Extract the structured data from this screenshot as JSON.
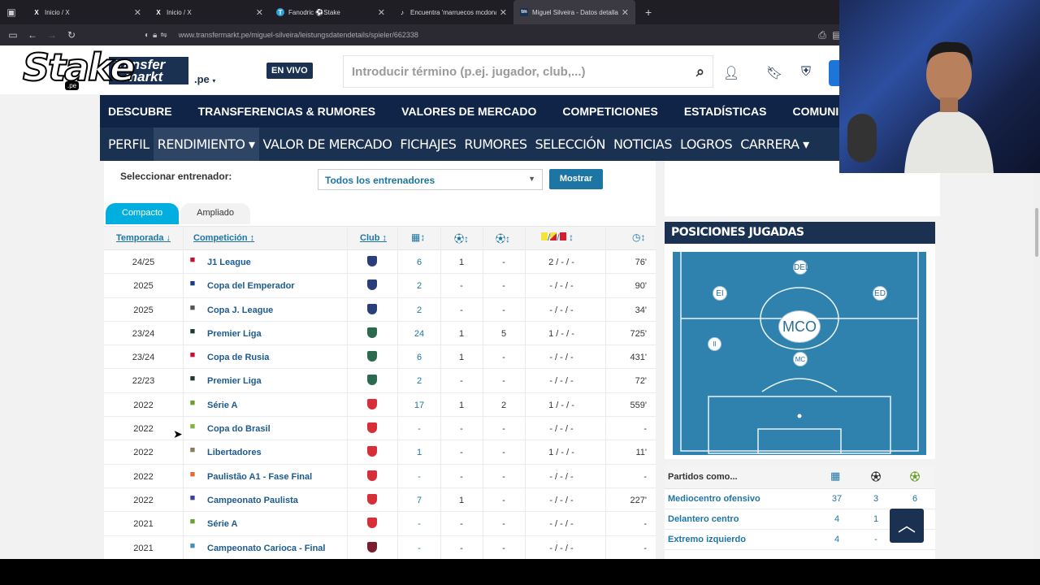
{
  "browser": {
    "tabs": [
      {
        "title": "Inicio / X",
        "icon": "X"
      },
      {
        "title": "Inicio / X",
        "icon": "X"
      },
      {
        "title": "Fanodric ⚽Stake",
        "icon": "T"
      },
      {
        "title": "Encuentra 'marruecos mcdonal",
        "icon": "♪"
      },
      {
        "title": "Miguel Silveira - Datos detallad",
        "icon": "tm"
      }
    ],
    "url": "www.transfermarkt.pe/miguel-silveira/leistungsdatendetails/spieler/662338"
  },
  "overlay": {
    "stake_logo": "Stake",
    "stake_sub": ".pe"
  },
  "site": {
    "logo_line1": "transfer",
    "logo_line2": "markt",
    "domain": ".pe",
    "live_badge": "EN VIVO",
    "search_placeholder": "Introducir término (p.ej. jugador, club,...)"
  },
  "main_nav": [
    "DESCUBRE",
    "TRANSFERENCIAS & RUMORES",
    "VALORES DE MERCADO",
    "COMPETICIONES",
    "ESTADÍSTICAS",
    "COMUNIDAD"
  ],
  "sub_nav": [
    "PERFIL",
    "RENDIMIENTO ▾",
    "VALOR DE MERCADO",
    "FICHAJES",
    "RUMORES",
    "SELECCIÓN",
    "NOTICIAS",
    "LOGROS",
    "CARRERA ▾"
  ],
  "filters": {
    "coach_label": "Seleccionar entrenador:",
    "coach_value": "Todos los entrenadores",
    "show_button": "Mostrar"
  },
  "view_tabs": {
    "compact": "Compacto",
    "wide": "Ampliado"
  },
  "table": {
    "headers": {
      "season": "Temporada ↓",
      "competition": "Competición ↕",
      "club": "Club ↕"
    },
    "rows": [
      {
        "season": "24/25",
        "competition": "J1 League",
        "apps": "6",
        "goals": "1",
        "assists": "-",
        "cards": "2 / - / -",
        "minutes": "76'",
        "logo_color": "#c8102e",
        "club_color": "#2a3f7a"
      },
      {
        "season": "2025",
        "competition": "Copa del Emperador",
        "apps": "2",
        "goals": "-",
        "assists": "-",
        "cards": "- / - / -",
        "minutes": "90'",
        "logo_color": "#1a3a8a",
        "club_color": "#2a3f7a"
      },
      {
        "season": "2025",
        "competition": "Copa J. League",
        "apps": "2",
        "goals": "-",
        "assists": "-",
        "cards": "- / - / -",
        "minutes": "34'",
        "logo_color": "#555555",
        "club_color": "#2a3f7a"
      },
      {
        "season": "23/24",
        "competition": "Premier Liga",
        "apps": "24",
        "goals": "1",
        "assists": "5",
        "cards": "1 / - / -",
        "minutes": "725'",
        "logo_color": "#1f3a2a",
        "club_color": "#2c6a50"
      },
      {
        "season": "23/24",
        "competition": "Copa de Rusia",
        "apps": "6",
        "goals": "1",
        "assists": "-",
        "cards": "- / - / -",
        "minutes": "431'",
        "logo_color": "#c8102e",
        "club_color": "#2c6a50"
      },
      {
        "season": "22/23",
        "competition": "Premier Liga",
        "apps": "2",
        "goals": "-",
        "assists": "-",
        "cards": "- / - / -",
        "minutes": "72'",
        "logo_color": "#1f3a2a",
        "club_color": "#2c6a50"
      },
      {
        "season": "2022",
        "competition": "Série A",
        "apps": "17",
        "goals": "1",
        "assists": "2",
        "cards": "1 / - / -",
        "minutes": "559'",
        "logo_color": "#6aa12d",
        "club_color": "#d62f3a"
      },
      {
        "season": "2022",
        "competition": "Copa do Brasil",
        "apps": "-",
        "goals": "-",
        "assists": "-",
        "cards": "- / - / -",
        "minutes": "-",
        "logo_color": "#7fb241",
        "club_color": "#d62f3a"
      },
      {
        "season": "2022",
        "competition": "Libertadores",
        "apps": "1",
        "goals": "-",
        "assists": "-",
        "cards": "1 / - / -",
        "minutes": "11'",
        "logo_color": "#8a7b5b",
        "club_color": "#d62f3a"
      },
      {
        "season": "2022",
        "competition": "Paulistão A1 - Fase Final",
        "apps": "-",
        "goals": "-",
        "assists": "-",
        "cards": "- / - / -",
        "minutes": "-",
        "logo_color": "#e26b2d",
        "club_color": "#d62f3a"
      },
      {
        "season": "2022",
        "competition": "Campeonato Paulista",
        "apps": "7",
        "goals": "1",
        "assists": "-",
        "cards": "- / - / -",
        "minutes": "227'",
        "logo_color": "#3b3f9e",
        "club_color": "#d62f3a"
      },
      {
        "season": "2021",
        "competition": "Série A",
        "apps": "-",
        "goals": "-",
        "assists": "-",
        "cards": "- / - / -",
        "minutes": "-",
        "logo_color": "#6aa12d",
        "club_color": "#d62f3a"
      },
      {
        "season": "2021",
        "competition": "Campeonato Carioca - Final",
        "apps": "-",
        "goals": "-",
        "assists": "-",
        "cards": "- / - / -",
        "minutes": "-",
        "logo_color": "#4a8fb8",
        "club_color": "#7a1d2f"
      }
    ]
  },
  "positions": {
    "title": "POSICIONES JUGADAS",
    "labels": {
      "del": "DEL",
      "ei": "EI",
      "ed": "ED",
      "mco": "MCO",
      "li": "II",
      "mc": "MC"
    }
  },
  "played_as": {
    "header": "Partidos como...",
    "rows": [
      {
        "position": "Mediocentro ofensivo",
        "apps": "37",
        "goals": "3",
        "assists": "6"
      },
      {
        "position": "Delantero centro",
        "apps": "4",
        "goals": "1",
        "assists": ""
      },
      {
        "position": "Extremo izquierdo",
        "apps": "4",
        "goals": "-",
        "assists": ""
      }
    ]
  },
  "colors": {
    "navy": "#1a3151",
    "nav_dark": "#0f2446",
    "link_blue": "#1d75a3",
    "pitch": "#2f82ad",
    "tab_cyan": "#00aee0"
  }
}
